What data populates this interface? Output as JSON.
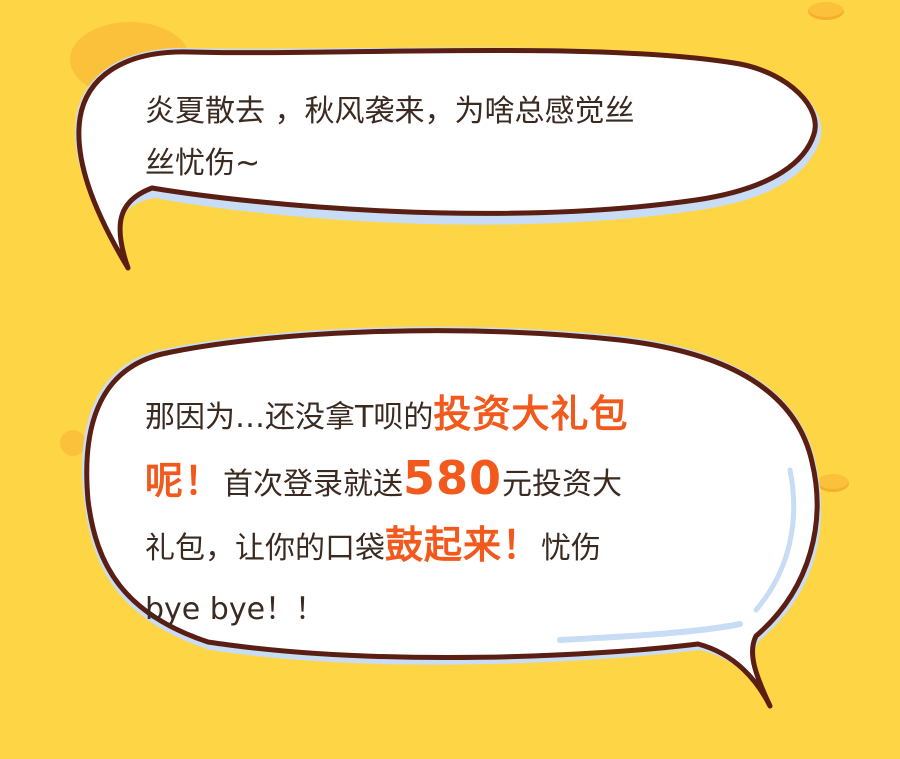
{
  "bubble_top": {
    "line1": "炎夏散去 ，秋风袭来，为啥总感觉丝",
    "line2": "丝忧伤~"
  },
  "bubble_bottom": {
    "seg1": "那因为…还没拿T呗的",
    "hl1": "投资大礼包",
    "hl2": "呢！",
    "seg2": "首次登录就送",
    "hl3": "580",
    "seg3": "元投资大",
    "seg4": "礼包，让你的口袋",
    "hl4": "鼓起来！",
    "seg5": "忧伤",
    "seg6": "bye bye！！"
  },
  "colors": {
    "background": "#fdd545",
    "highlight": "#f25a1d",
    "outline": "#5a1e12",
    "bubble_fill": "#ffffff",
    "bubble_shadow": "#c8dcf6"
  }
}
